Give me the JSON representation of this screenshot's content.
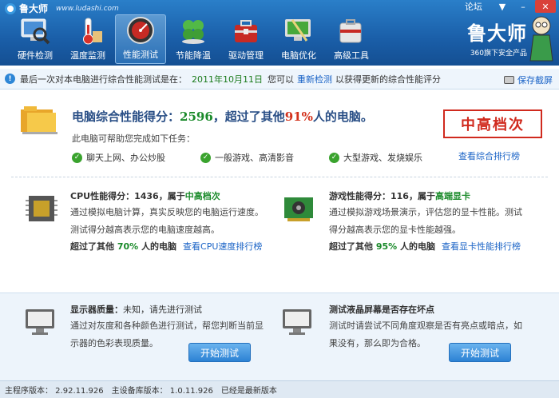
{
  "app": {
    "name": "鲁大师",
    "url": "www.ludashi.com"
  },
  "window": {
    "forum_label": "论坛",
    "minimize": "–",
    "menu": "▼",
    "close": "✕"
  },
  "nav": [
    {
      "label": "硬件检测",
      "icon": "monitor-magnifier-icon"
    },
    {
      "label": "温度监测",
      "icon": "thermometer-icon"
    },
    {
      "label": "性能测试",
      "icon": "speedometer-icon"
    },
    {
      "label": "节能降温",
      "icon": "clover-icon"
    },
    {
      "label": "驱动管理",
      "icon": "toolbox-icon"
    },
    {
      "label": "电脑优化",
      "icon": "broom-monitor-icon"
    },
    {
      "label": "高级工具",
      "icon": "tools-icon"
    }
  ],
  "brand_logo": {
    "title": "鲁大师",
    "subtitle": "360旗下安全产品"
  },
  "infobar": {
    "prefix": "最后一次对本电脑进行综合性能测试是在：",
    "date": "2011年10月11日",
    "mid": "您可以",
    "retest": "重新检测",
    "suffix": "以获得更新的综合性能评分",
    "screenshot": "保存截屏"
  },
  "score": {
    "label": "电脑综合性能得分：",
    "value": "2596",
    "mid": "，超过了其他",
    "percent": "91%",
    "suffix": "人的电脑。",
    "help": "此电脑可帮助您完成如下任务：",
    "tasks": [
      "聊天上网、办公炒股",
      "一般游戏、高清影音",
      "大型游戏、发烧娱乐"
    ],
    "stamp": "中高档次",
    "rank_link": "查看综合排行榜"
  },
  "cpu": {
    "title_pre": "CPU性能得分：",
    "score": "1436",
    "title_mid": "，属于",
    "level": "中高档次",
    "desc1": "通过模拟电脑计算，真实反映您的电脑运行速度。",
    "desc2": "测试得分越高表示您的电脑速度越高。",
    "foot_pre": "超过了其他",
    "percent": "70%",
    "foot_suf": "人的电脑",
    "link": "查看CPU速度排行榜"
  },
  "game": {
    "title_pre": "游戏性能得分：",
    "score": "116",
    "title_mid": "，属于",
    "level": "高端显卡",
    "desc1": "通过模拟游戏场景演示，评估您的显卡性能。测试",
    "desc2": "得分越高表示您的显卡性能越强。",
    "foot_pre": "超过了其他",
    "percent": "95%",
    "foot_suf": "人的电脑",
    "link": "查看显卡性能排行榜"
  },
  "display": {
    "title": "显示器质量：",
    "title_val": "未知，请先进行测试",
    "desc1": "通过对灰度和各种颜色进行测试，帮您判断当前显",
    "desc2": "示器的色彩表现质量。",
    "button": "开始测试"
  },
  "lcd": {
    "title": "测试液晶屏幕是否存在坏点",
    "desc1": "测试时请尝试不同角度观察是否有亮点或暗点，如",
    "desc2": "果没有，那么即为合格。",
    "button": "开始测试"
  },
  "status": {
    "main_ver": "主程序版本：  2.92.11.926",
    "db_ver": "主设备库版本：  1.0.11.926",
    "latest": "已经是最新版本"
  }
}
